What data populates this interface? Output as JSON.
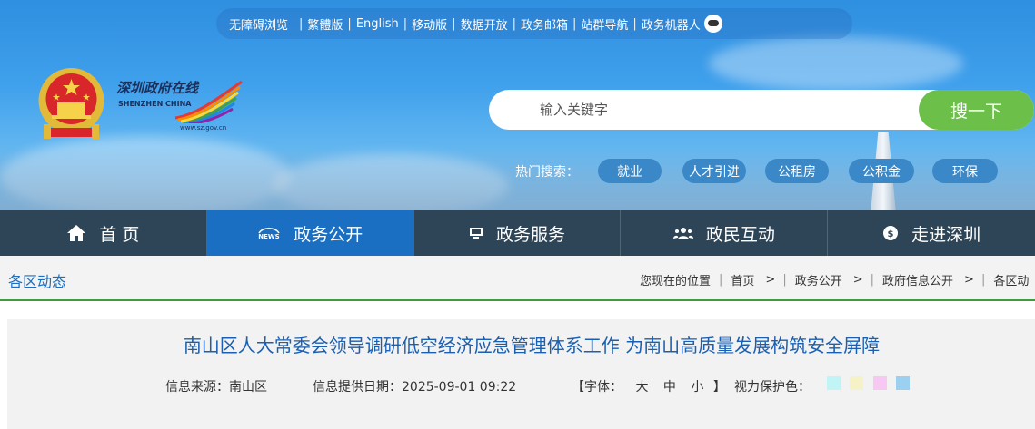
{
  "toplinks": [
    {
      "label": "无障碍浏览"
    },
    {
      "label": "繁體版"
    },
    {
      "label": "English"
    },
    {
      "label": "移动版"
    },
    {
      "label": "数据开放"
    },
    {
      "label": "政务邮箱"
    },
    {
      "label": "站群导航"
    },
    {
      "label": "政务机器人"
    }
  ],
  "logo": {
    "cn": "深圳政府在线",
    "en": "SHENZHEN CHINA",
    "url": "www.sz.gov.cn"
  },
  "search": {
    "placeholder": "输入关键字",
    "button": "搜一下"
  },
  "hot": {
    "label": "热门搜索：",
    "tags": [
      "就业",
      "人才引进",
      "公租房",
      "公积金",
      "环保"
    ]
  },
  "nav": [
    {
      "label": "首 页",
      "icon": "home-icon"
    },
    {
      "label": "政务公开",
      "icon": "news-icon"
    },
    {
      "label": "政务服务",
      "icon": "monitor-icon"
    },
    {
      "label": "政民互动",
      "icon": "people-icon"
    },
    {
      "label": "走进深圳",
      "icon": "chat-icon"
    }
  ],
  "section_title": "各区动态",
  "breadcrumb": {
    "lead": "您现在的位置",
    "items": [
      "首页",
      "政务公开",
      "政府信息公开",
      "各区动"
    ]
  },
  "article": {
    "title": "南山区人大常委会领导调研低空经济应急管理体系工作 为南山高质量发展构筑安全屏障",
    "source": "信息来源：南山区",
    "date": "信息提供日期：2025-09-01 09:22",
    "font_label": "【字体：",
    "font_large": "大",
    "font_medium": "中",
    "font_small": "小",
    "font_close": "】",
    "eye_label": "视力保护色："
  },
  "colors": {
    "nav_active": "#1a6fc2",
    "nav_bg": "#2d4556",
    "search_button": "#6cc04a",
    "title": "#1a5fb0",
    "swatches": [
      "#c0f4f7",
      "#f5f2c8",
      "#f7c8f2",
      "#9bd0f0"
    ]
  }
}
